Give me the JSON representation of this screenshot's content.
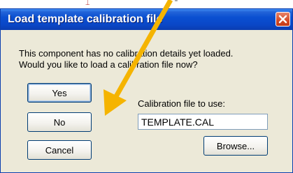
{
  "dialog": {
    "title": "Load template calibration file",
    "message_line1": "This component has no calibration details yet loaded.",
    "message_line2": "Would you like to load a calibration file now?",
    "buttons": {
      "yes": "Yes",
      "no": "No",
      "cancel": "Cancel",
      "browse": "Browse..."
    },
    "calibration_label": "Calibration file to use:",
    "calibration_value": "TEMPLATE.CAL"
  },
  "icons": {
    "close": "close-icon",
    "annotation": "arrow-annotation-icon"
  },
  "colors": {
    "titlebar": "#0a4fd1",
    "dialog_bg": "#ece9d8",
    "close_button": "#d44a26",
    "annotation_arrow": "#f5b400"
  }
}
